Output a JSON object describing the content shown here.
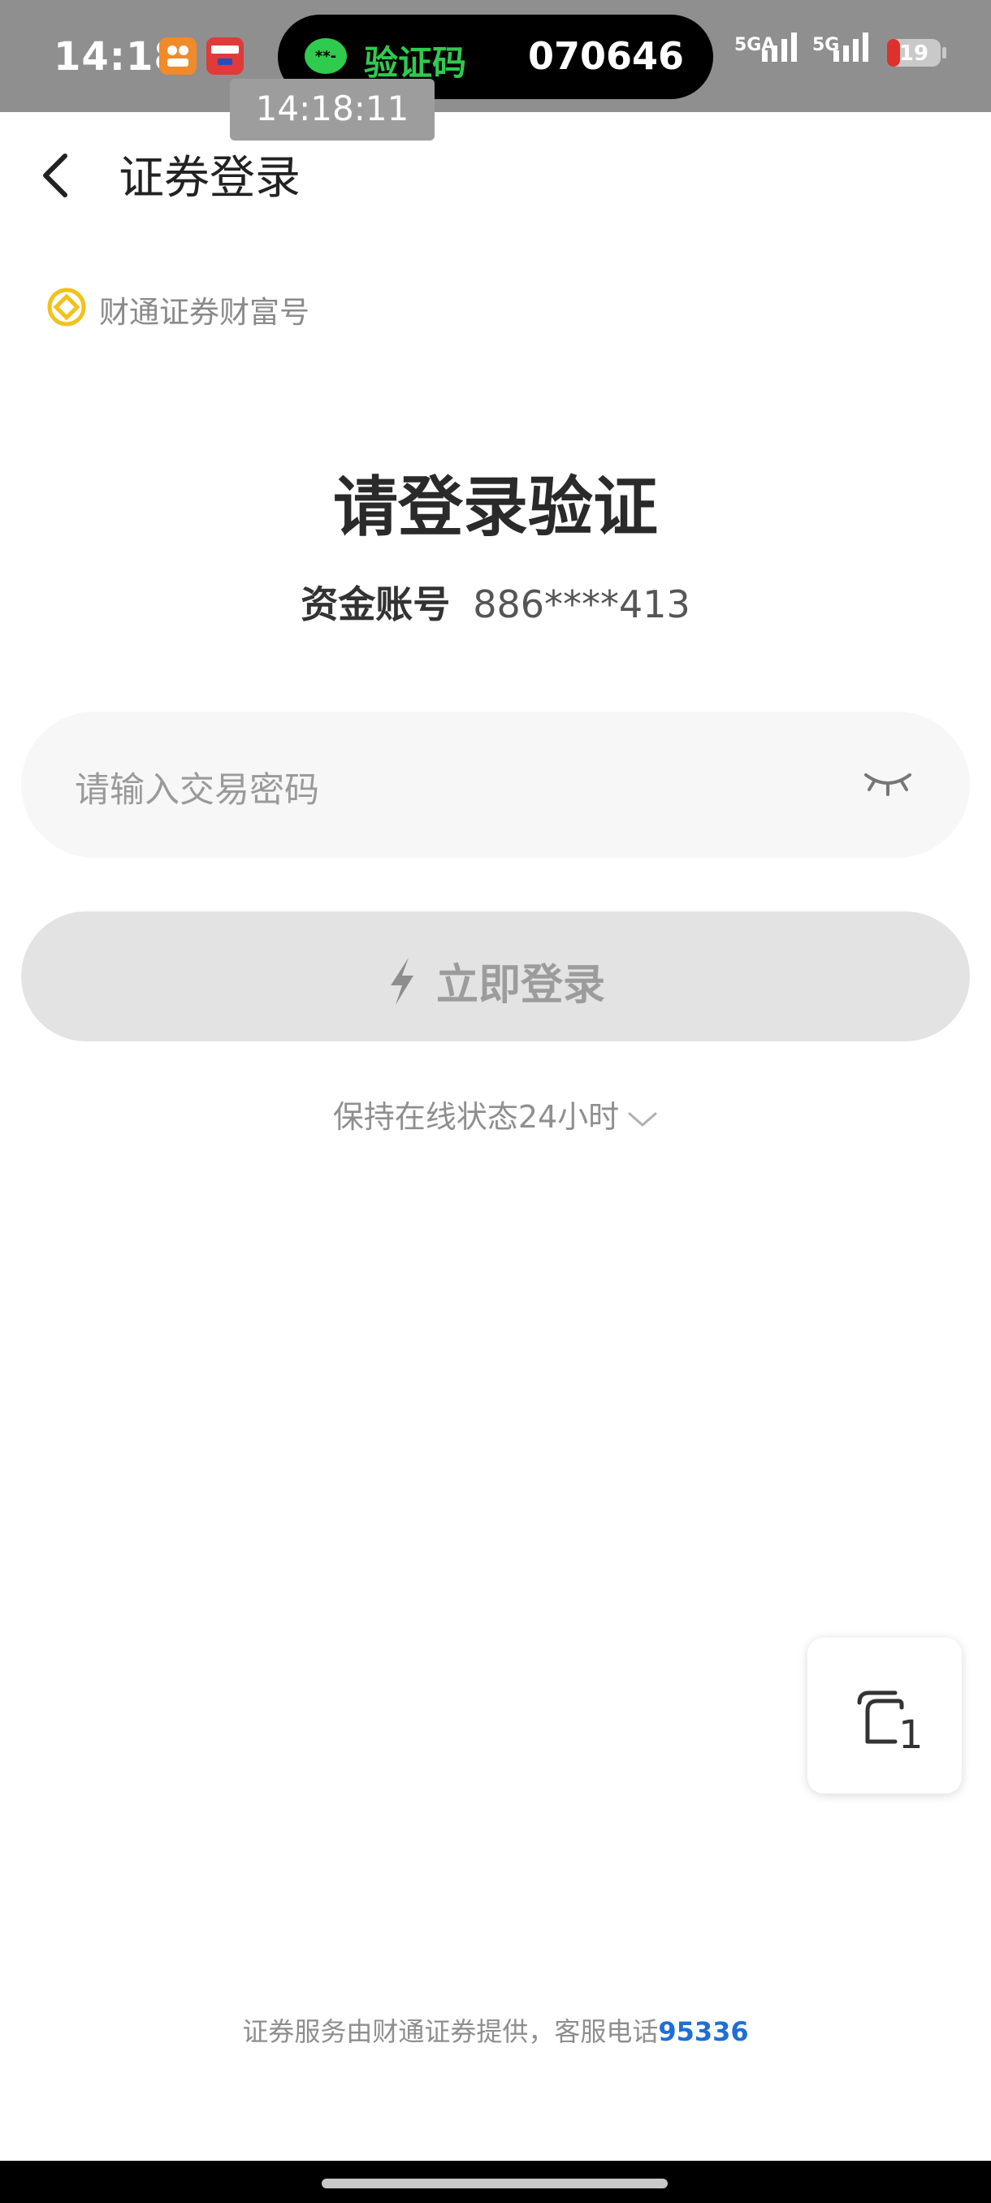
{
  "status_bar": {
    "time": "14:18",
    "notification": {
      "label": "验证码",
      "code": "070646"
    },
    "overlay_time": "14:18:11",
    "network": [
      "5GA",
      "5G"
    ],
    "battery": "19"
  },
  "nav": {
    "title": "证券登录"
  },
  "brand": {
    "name": "财通证券财富号"
  },
  "main": {
    "heading": "请登录验证",
    "account_label": "资金账号",
    "account_value": "886****413",
    "password_placeholder": "请输入交易密码",
    "login_label": "立即登录",
    "keep_online": "保持在线状态24小时"
  },
  "float_button": {
    "count": "1"
  },
  "footer": {
    "text": "证券服务由财通证券提供，客服电话",
    "phone": "95336"
  },
  "colors": {
    "status_bar_bg": "#8f8f8f",
    "notification_green": "#2ecb4f",
    "brand_icon_yellow": "#f2c21b",
    "link_blue": "#1e6fd6",
    "button_disabled": "#e3e3e3"
  },
  "icons": [
    "back-chevron-icon",
    "brand-logo-icon",
    "eye-closed-icon",
    "lightning-icon",
    "chevron-down-icon",
    "stacked-pages-icon",
    "message-icon"
  ]
}
